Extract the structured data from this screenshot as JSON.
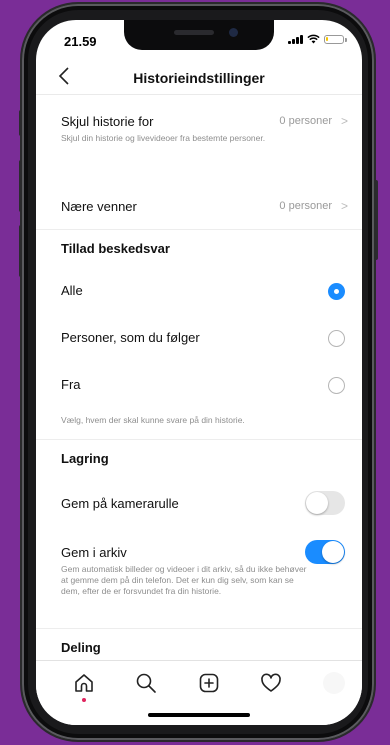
{
  "status": {
    "time": "21.59"
  },
  "nav": {
    "back_icon": "chevron-left-icon",
    "title": "Historieindstillinger"
  },
  "rows": {
    "hide_story": {
      "label": "Skjul historie for",
      "desc": "Skjul din historie og livevideoer fra bestemte personer.",
      "value": "0 personer"
    },
    "close_friends": {
      "label": "Nære venner",
      "value": "0 personer"
    }
  },
  "replies": {
    "section": "Tillad beskedsvar",
    "options": [
      {
        "label": "Alle",
        "selected": true
      },
      {
        "label": "Personer, som du følger",
        "selected": false
      },
      {
        "label": "Fra",
        "selected": false
      }
    ],
    "note": "Vælg, hvem der skal kunne svare på din historie."
  },
  "storage": {
    "section": "Lagring",
    "camera_roll": {
      "label": "Gem på kamerarulle",
      "on": false
    },
    "archive": {
      "label": "Gem i arkiv",
      "on": true,
      "desc": "Gem automatisk billeder og videoer i dit arkiv, så du ikke behøver at gemme dem på din telefon. Det er kun dig selv, som kan se dem, efter de er forsvundet fra din historie."
    }
  },
  "sharing": {
    "section": "Deling"
  },
  "tabbar": {
    "icons": [
      "home-icon",
      "search-icon",
      "add-post-icon",
      "heart-icon",
      "profile-icon"
    ]
  },
  "colors": {
    "accent": "#1a8cff",
    "background": "#7a2d97"
  }
}
